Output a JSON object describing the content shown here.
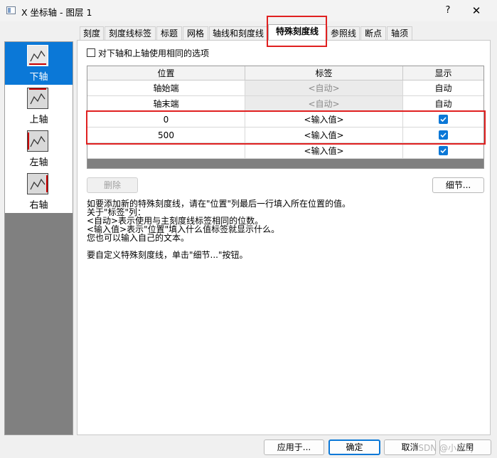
{
  "window": {
    "title": "X 坐标轴 - 图层 1",
    "help_label": "?",
    "close_label": "✕"
  },
  "axes": [
    {
      "label": "下轴",
      "selected": true
    },
    {
      "label": "上轴",
      "selected": false
    },
    {
      "label": "左轴",
      "selected": false
    },
    {
      "label": "右轴",
      "selected": false
    }
  ],
  "tabs": [
    {
      "label": "刻度"
    },
    {
      "label": "刻度线标签"
    },
    {
      "label": "标题"
    },
    {
      "label": "网格"
    },
    {
      "label": "轴线和刻度线"
    },
    {
      "label": "特殊刻度线",
      "active": true
    },
    {
      "label": "参照线"
    },
    {
      "label": "断点"
    },
    {
      "label": "轴须"
    }
  ],
  "options": {
    "same_options_label": "对下轴和上轴使用相同的选项",
    "same_options_checked": false
  },
  "grid": {
    "headers": [
      "位置",
      "标签",
      "显示"
    ],
    "rows": [
      {
        "position": "轴始端",
        "label": "<自动>",
        "label_disabled": true,
        "display": "自动",
        "display_check": false
      },
      {
        "position": "轴末端",
        "label": "<自动>",
        "label_disabled": true,
        "display": "自动",
        "display_check": false
      },
      {
        "position": "0",
        "label": "<输入值>",
        "label_disabled": false,
        "display": "",
        "display_check": true
      },
      {
        "position": "500",
        "label": "<输入值>",
        "label_disabled": false,
        "display": "",
        "display_check": true
      },
      {
        "position": "",
        "label": "<输入值>",
        "label_disabled": false,
        "display": "",
        "display_check": true
      }
    ]
  },
  "buttons": {
    "delete": "删除",
    "details": "细节...",
    "apply_to": "应用于...",
    "ok": "确定",
    "cancel": "取消",
    "apply": "应用"
  },
  "help_text": [
    "如要添加新的特殊刻度线，请在\"位置\"列最后一行填入所在位置的值。",
    "关于\"标签\"列：",
    "<自动>表示使用与主刻度线标签相同的位数。",
    "<输入值>表示\"位置\"填入什么值标签就显示什么。",
    "您也可以输入自己的文本。",
    "",
    "要自定义特殊刻度线，单击\"细节...\"按钮。"
  ],
  "watermark": "CSDN @小王Zj",
  "colors": {
    "accent": "#0b78d7",
    "highlight_box": "#e02020",
    "panel_grey": "#808080"
  },
  "icons": [
    "axis-icon",
    "check-icon",
    "help-icon",
    "close-icon"
  ]
}
